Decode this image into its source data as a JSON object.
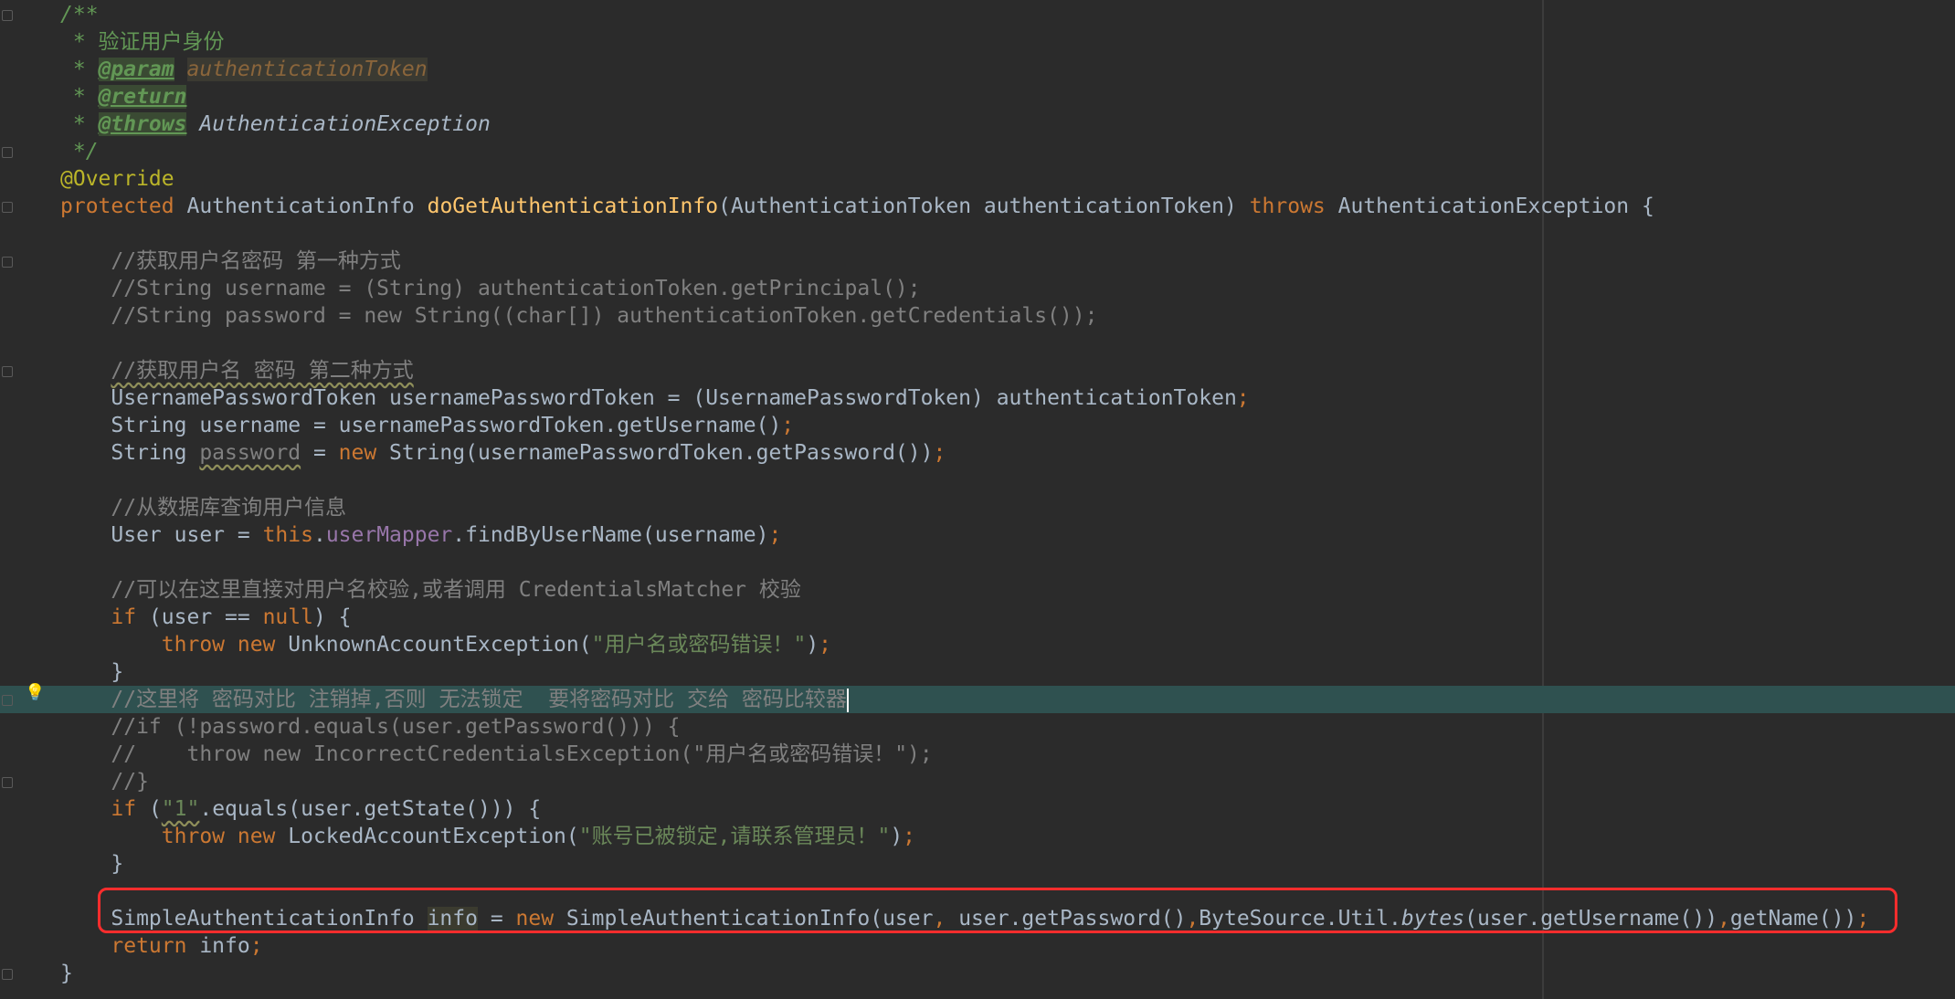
{
  "editor": {
    "lines": [
      [
        {
          "t": "/**",
          "c": "doc"
        }
      ],
      [
        {
          "t": " * ",
          "c": "doc"
        },
        {
          "t": "验证用户身份",
          "c": "doc-cn"
        }
      ],
      [
        {
          "t": " * ",
          "c": "doc"
        },
        {
          "t": "@param",
          "c": "tag"
        },
        {
          "t": " ",
          "c": "doc"
        },
        {
          "t": "authenticationToken",
          "c": "param-name"
        }
      ],
      [
        {
          "t": " * ",
          "c": "doc"
        },
        {
          "t": "@return",
          "c": "tag"
        }
      ],
      [
        {
          "t": " * ",
          "c": "doc"
        },
        {
          "t": "@throws",
          "c": "tag"
        },
        {
          "t": " ",
          "c": "doc"
        },
        {
          "t": "AuthenticationException",
          "c": "exc-ref"
        }
      ],
      [
        {
          "t": " */",
          "c": "doc"
        }
      ],
      [
        {
          "t": "@Override",
          "c": "anno"
        }
      ],
      [
        {
          "t": "protected ",
          "c": "kw"
        },
        {
          "t": "AuthenticationInfo ",
          "c": ""
        },
        {
          "t": "doGetAuthenticationInfo",
          "c": "fn"
        },
        {
          "t": "(AuthenticationToken authenticationToken) ",
          "c": ""
        },
        {
          "t": "throws ",
          "c": "kw"
        },
        {
          "t": "AuthenticationException {",
          "c": ""
        }
      ],
      [],
      [
        {
          "t": "    //获取用户名密码 第一种方式",
          "c": "cm"
        }
      ],
      [
        {
          "t": "    //String username = (String) authenticationToken.getPrincipal();",
          "c": "cm"
        }
      ],
      [
        {
          "t": "    //String password = new String((char[]) authenticationToken.getCredentials());",
          "c": "cm"
        }
      ],
      [],
      [
        {
          "t": "    ",
          "c": "cm"
        },
        {
          "t": "//获取用户名 密码 第二种方式",
          "c": "cm squig"
        }
      ],
      [
        {
          "t": "    UsernamePasswordToken usernamePasswordToken = (UsernamePasswordToken) authenticationToken",
          "c": ""
        },
        {
          "t": ";",
          "c": "punct"
        }
      ],
      [
        {
          "t": "    String username = usernamePasswordToken.getUsername()",
          "c": ""
        },
        {
          "t": ";",
          "c": "punct"
        }
      ],
      [
        {
          "t": "    String ",
          "c": ""
        },
        {
          "t": "password",
          "c": "cm squig"
        },
        {
          "t": " = ",
          "c": ""
        },
        {
          "t": "new ",
          "c": "kw"
        },
        {
          "t": "String(usernamePasswordToken.getPassword())",
          "c": ""
        },
        {
          "t": ";",
          "c": "punct"
        }
      ],
      [],
      [
        {
          "t": "    //从数据库查询用户信息",
          "c": "cm"
        }
      ],
      [
        {
          "t": "    User user = ",
          "c": ""
        },
        {
          "t": "this",
          "c": "kw"
        },
        {
          "t": ".",
          "c": ""
        },
        {
          "t": "userMapper",
          "c": "field"
        },
        {
          "t": ".findByUserName(username)",
          "c": ""
        },
        {
          "t": ";",
          "c": "punct"
        }
      ],
      [],
      [
        {
          "t": "    //可以在这里直接对用户名校验,或者调用 CredentialsMatcher 校验",
          "c": "cm"
        }
      ],
      [
        {
          "t": "    ",
          "c": ""
        },
        {
          "t": "if ",
          "c": "kw"
        },
        {
          "t": "(user == ",
          "c": ""
        },
        {
          "t": "null",
          "c": "kw"
        },
        {
          "t": ") {",
          "c": ""
        }
      ],
      [
        {
          "t": "        ",
          "c": ""
        },
        {
          "t": "throw new ",
          "c": "kw"
        },
        {
          "t": "UnknownAccountException(",
          "c": ""
        },
        {
          "t": "\"用户名或密码错误！\"",
          "c": "str"
        },
        {
          "t": ")",
          "c": ""
        },
        {
          "t": ";",
          "c": "punct"
        }
      ],
      [
        {
          "t": "    }",
          "c": ""
        }
      ],
      [
        {
          "t": "    //这里将 密码对比 注销掉,否则 无法锁定  要将密码对比 交给 密码比较器",
          "c": "cm"
        },
        {
          "t": "",
          "c": "caret"
        }
      ],
      [
        {
          "t": "    //if (!password.equals(user.getPassword())) {",
          "c": "cm"
        }
      ],
      [
        {
          "t": "    //    throw new IncorrectCredentialsException(\"用户名或密码错误！\");",
          "c": "cm"
        }
      ],
      [
        {
          "t": "    //}",
          "c": "cm"
        }
      ],
      [
        {
          "t": "    ",
          "c": ""
        },
        {
          "t": "if ",
          "c": "kw"
        },
        {
          "t": "(",
          "c": ""
        },
        {
          "t": "\"1\"",
          "c": "str squig"
        },
        {
          "t": ".equals(user.getState())) {",
          "c": ""
        }
      ],
      [
        {
          "t": "        ",
          "c": ""
        },
        {
          "t": "throw new ",
          "c": "kw"
        },
        {
          "t": "LockedAccountException(",
          "c": ""
        },
        {
          "t": "\"账号已被锁定,请联系管理员！\"",
          "c": "str"
        },
        {
          "t": ")",
          "c": ""
        },
        {
          "t": ";",
          "c": "punct"
        }
      ],
      [
        {
          "t": "    }",
          "c": ""
        }
      ],
      [],
      [
        {
          "t": "    SimpleAuthenticationInfo ",
          "c": ""
        },
        {
          "t": "info",
          "c": "usage"
        },
        {
          "t": " = ",
          "c": ""
        },
        {
          "t": "new ",
          "c": "kw"
        },
        {
          "t": "SimpleAuthenticationInfo(user",
          "c": ""
        },
        {
          "t": ", ",
          "c": "punct"
        },
        {
          "t": "user.getPassword()",
          "c": ""
        },
        {
          "t": ",",
          "c": "punct"
        },
        {
          "t": "ByteSource.Util.",
          "c": ""
        },
        {
          "t": "bytes",
          "c": "ital"
        },
        {
          "t": "(user.getUsername())",
          "c": ""
        },
        {
          "t": ",",
          "c": "punct"
        },
        {
          "t": "getName())",
          "c": ""
        },
        {
          "t": ";",
          "c": "punct"
        }
      ],
      [
        {
          "t": "    ",
          "c": ""
        },
        {
          "t": "return ",
          "c": "kw"
        },
        {
          "t": "info",
          "c": ""
        },
        {
          "t": ";",
          "c": "punct"
        }
      ],
      [
        {
          "t": "}",
          "c": ""
        }
      ]
    ],
    "current_line_index": 25,
    "fold_marker_lines": [
      0,
      5,
      7,
      9,
      13,
      25,
      28,
      35
    ]
  },
  "colors": {
    "background": "#2b2b2b",
    "current_line": "#2f5150",
    "highlight_box": "#ff2d2d"
  },
  "icons": {
    "gutter_bulb": "lightbulb-icon",
    "fold_marker": "fold-marker-icon"
  }
}
